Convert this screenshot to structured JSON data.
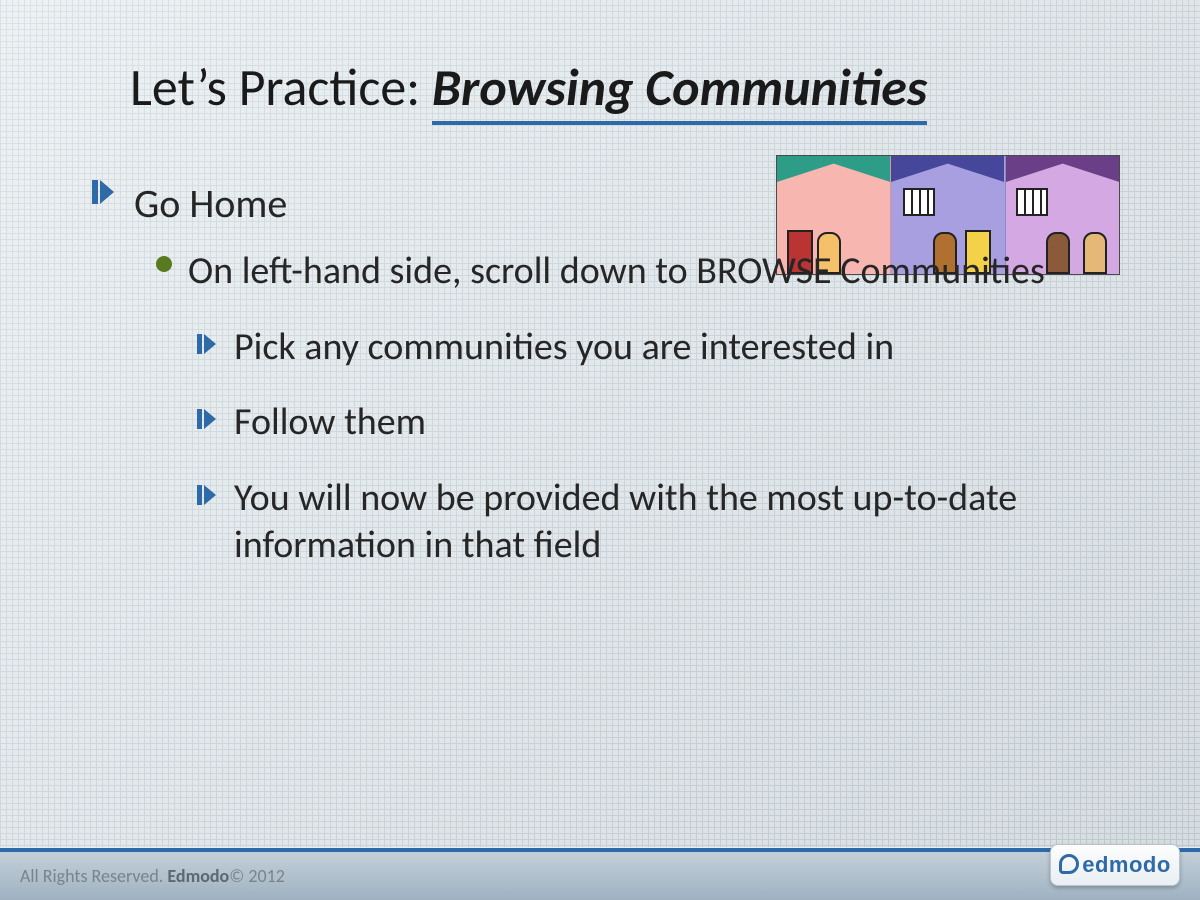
{
  "title": {
    "plain": "Let’s Practice:  ",
    "emph": "Browsing Communities"
  },
  "bullets": {
    "top": "Go Home",
    "dot": "On left-hand side, scroll down to BROWSE Communities",
    "arrows": [
      "Pick any communities you are interested in",
      "Follow them",
      "You will now be provided with the most up-to-date information in that field"
    ]
  },
  "footer": {
    "reserved": "All Rights Reserved. ",
    "brand": "Edmodo",
    "copyright": " © 2012"
  },
  "logo": {
    "text": "edmodo"
  },
  "colors": {
    "accent": "#2f6aa8",
    "olive_dot": "#5a7a1f"
  }
}
